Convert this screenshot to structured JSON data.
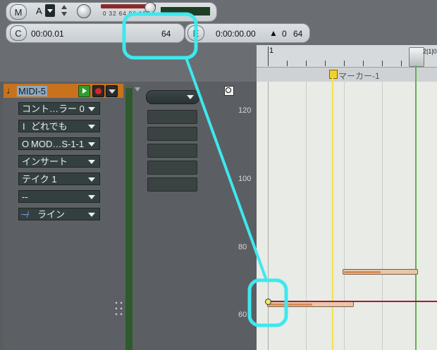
{
  "transport": {
    "m_label": "M",
    "a_label": "A",
    "meter_scale": "0 32 64 96 127",
    "c_label": "C",
    "c_time": "00:00.01",
    "c_value": "64",
    "e_label": "E",
    "e_time": "0:00:00.00",
    "e_arrow": "▲",
    "e_v1": "0",
    "e_v2": "64"
  },
  "ruler": {
    "bar1": "1",
    "marker_label": "マーカー-1"
  },
  "track": {
    "name": "MIDI-5",
    "dropdowns": [
      {
        "label": "コント…ラー 0"
      },
      {
        "label": "どれでも"
      },
      {
        "label": "MOD…S-1-1"
      },
      {
        "label": "インサート"
      },
      {
        "label": "テイク 1"
      },
      {
        "label": "--"
      },
      {
        "label": "ライン"
      }
    ]
  },
  "yaxis": {
    "labels": [
      "120",
      "100",
      "80",
      "60"
    ]
  },
  "colors": {
    "cyan_highlight": "#3ee8ee",
    "marker_yellow": "#f2e14a",
    "playhead_green": "#5fb34a",
    "env_line": "#a41c3a",
    "track_header": "#c8721e"
  }
}
